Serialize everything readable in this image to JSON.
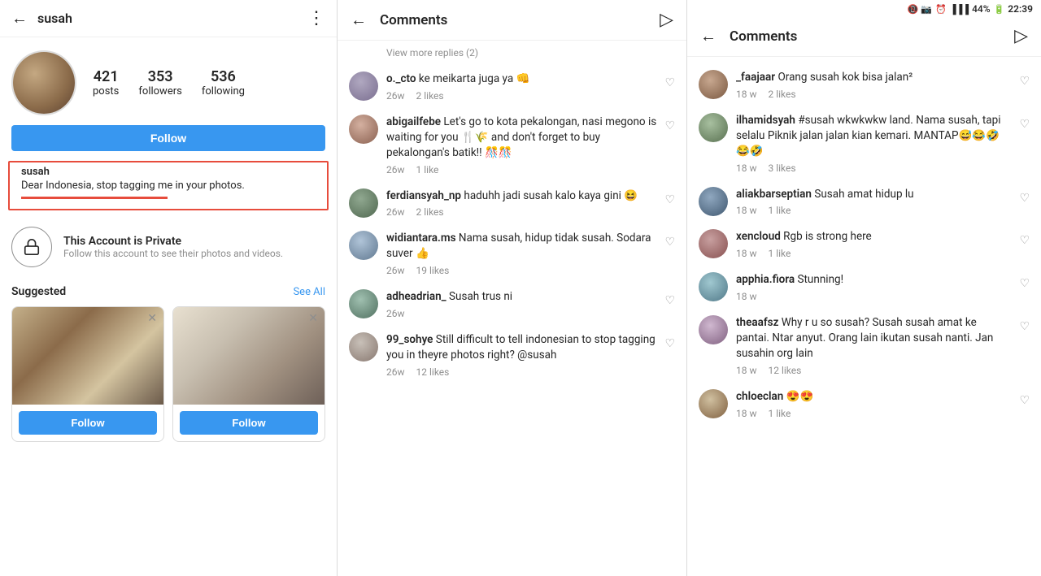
{
  "profile": {
    "back_label": "←",
    "username": "susah",
    "more_icon": "⋮",
    "stats": {
      "posts": {
        "number": "421",
        "label": "posts"
      },
      "followers": {
        "number": "353",
        "label": "followers"
      },
      "following": {
        "number": "536",
        "label": "following"
      }
    },
    "follow_button": "Follow",
    "bio": {
      "username": "susah",
      "text": "Dear Indonesia, stop tagging me in your photos."
    },
    "private": {
      "title": "This Account is Private",
      "subtitle": "Follow this account to see their photos and videos."
    },
    "suggested": {
      "title": "Suggested",
      "see_all": "See All",
      "cards": [
        {
          "follow_label": "Follow"
        },
        {
          "follow_label": "Follow"
        }
      ]
    }
  },
  "comments_middle": {
    "back_label": "←",
    "title": "Comments",
    "send_icon": "▷",
    "view_more": "View more replies (2)",
    "items": [
      {
        "username": "o._cto",
        "text": "ke meikarta juga ya 👊",
        "time": "26w",
        "likes": "2 likes"
      },
      {
        "username": "abigailfebe",
        "text": "Let's go to kota pekalongan, nasi megono is waiting for you 🍴🌾 and don't forget to buy pekalongan's batik!! 🎊🎊",
        "time": "26w",
        "likes": "1 like"
      },
      {
        "username": "ferdiansyah_np",
        "text": "haduhh jadi susah kalo kaya gini 😆",
        "time": "26w",
        "likes": "2 likes"
      },
      {
        "username": "widiantara.ms",
        "text": "Nama susah, hidup tidak susah. Sodara suver 👍",
        "time": "26w",
        "likes": "19 likes"
      },
      {
        "username": "adheadrian_",
        "text": "Susah trus ni",
        "time": "26w",
        "likes": ""
      },
      {
        "username": "99_sohye",
        "text": "Still difficult to tell indonesian to stop tagging you in theyre photos right? @susah",
        "time": "26w",
        "likes": "12 likes"
      }
    ]
  },
  "comments_right": {
    "status_bar": {
      "battery": "44%",
      "time": "22:39"
    },
    "back_label": "←",
    "title": "Comments",
    "send_icon": "▷",
    "items": [
      {
        "username": "_faajaar",
        "text": "Orang susah kok bisa jalan²",
        "time": "18 w",
        "likes": "2 likes"
      },
      {
        "username": "ilhamidsyah",
        "text": "#susah wkwkwkw land. Nama susah, tapi selalu Piknik jalan jalan kian kemari. MANTAP😅😂🤣😂🤣",
        "time": "18 w",
        "likes": "3 likes"
      },
      {
        "username": "aliakbarseptian",
        "text": "Susah amat hidup lu",
        "time": "18 w",
        "likes": "1 like"
      },
      {
        "username": "xencloud",
        "text": "Rgb is strong here",
        "time": "18 w",
        "likes": "1 like"
      },
      {
        "username": "apphia.fiora",
        "text": "Stunning!",
        "time": "18 w",
        "likes": ""
      },
      {
        "username": "theaafsz",
        "text": "Why r u so susah? Susah susah amat ke pantai. Ntar anyut. Orang lain ikutan susah nanti. Jan susahin org lain",
        "time": "18 w",
        "likes": "12 likes"
      },
      {
        "username": "chloeclan",
        "text": "😍😍",
        "time": "18 w",
        "likes": "1 like"
      }
    ]
  }
}
